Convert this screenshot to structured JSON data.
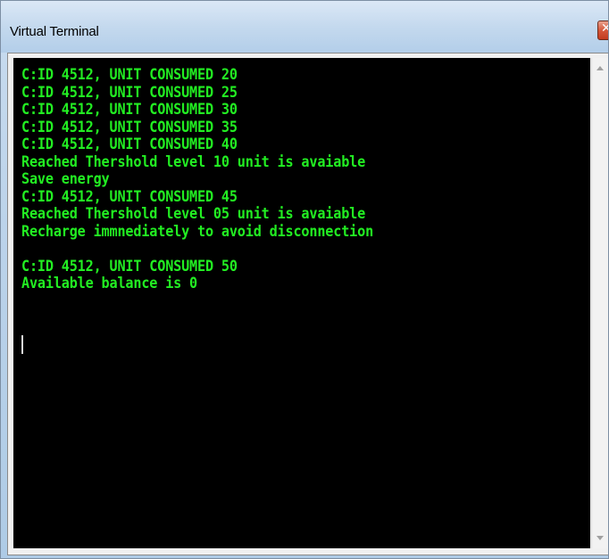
{
  "window": {
    "title": "Virtual Terminal",
    "close_symbol": "✕"
  },
  "terminal": {
    "text_color": "#22ee22",
    "background_color": "#000000",
    "lines": [
      "C:ID 4512, UNIT CONSUMED 20",
      "C:ID 4512, UNIT CONSUMED 25",
      "C:ID 4512, UNIT CONSUMED 30",
      "C:ID 4512, UNIT CONSUMED 35",
      "C:ID 4512, UNIT CONSUMED 40",
      "Reached Thershold level 10 unit is avaiable",
      "Save energy",
      "C:ID 4512, UNIT CONSUMED 45",
      "Reached Thershold level 05 unit is avaiable",
      "Recharge immnediately to avoid disconnection",
      "",
      "C:ID 4512, UNIT CONSUMED 50",
      "Available balance is 0"
    ]
  },
  "icons": {
    "close": "close-icon",
    "scroll_up": "scroll-up-arrow-icon",
    "scroll_down": "scroll-down-arrow-icon"
  }
}
